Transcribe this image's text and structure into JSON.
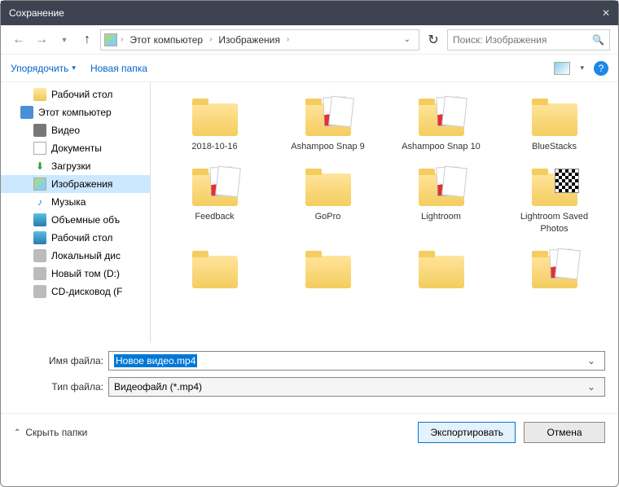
{
  "title": "Сохранение",
  "breadcrumb": {
    "root": "Этот компьютер",
    "current": "Изображения"
  },
  "search_placeholder": "Поиск: Изображения",
  "toolbar": {
    "organize": "Упорядочить",
    "new_folder": "Новая папка"
  },
  "sidebar": [
    {
      "icon": "folder",
      "label": "Рабочий стол",
      "level": 1
    },
    {
      "icon": "pc",
      "label": "Этот компьютер",
      "level": 0
    },
    {
      "icon": "video",
      "label": "Видео",
      "level": 1
    },
    {
      "icon": "doc",
      "label": "Документы",
      "level": 1
    },
    {
      "icon": "dl",
      "label": "Загрузки",
      "level": 1
    },
    {
      "icon": "img",
      "label": "Изображения",
      "level": 1,
      "selected": true
    },
    {
      "icon": "music",
      "label": "Музыка",
      "level": 1
    },
    {
      "icon": "desktop",
      "label": "Объемные объ",
      "level": 1
    },
    {
      "icon": "desktop",
      "label": "Рабочий стол",
      "level": 1
    },
    {
      "icon": "drive",
      "label": "Локальный дис",
      "level": 1
    },
    {
      "icon": "drive",
      "label": "Новый том (D:)",
      "level": 1
    },
    {
      "icon": "drive",
      "label": "CD-дисковод (F",
      "level": 1
    }
  ],
  "files": [
    {
      "label": "2018-10-16",
      "thumb": "folder"
    },
    {
      "label": "Ashampoo Snap 9",
      "thumb": "folder-docs"
    },
    {
      "label": "Ashampoo Snap 10",
      "thumb": "folder-docs"
    },
    {
      "label": "BlueStacks",
      "thumb": "folder"
    },
    {
      "label": "Feedback",
      "thumb": "folder-docs"
    },
    {
      "label": "GoPro",
      "thumb": "folder"
    },
    {
      "label": "Lightroom",
      "thumb": "folder-docs"
    },
    {
      "label": "Lightroom Saved Photos",
      "thumb": "folder-qr"
    },
    {
      "label": "",
      "thumb": "folder"
    },
    {
      "label": "",
      "thumb": "folder"
    },
    {
      "label": "",
      "thumb": "folder"
    },
    {
      "label": "",
      "thumb": "folder-docs"
    }
  ],
  "filename_label": "Имя файла:",
  "filename_value": "Новое видео.mp4",
  "filetype_label": "Тип файла:",
  "filetype_value": "Видеофайл (*.mp4)",
  "hide_folders": "Скрыть папки",
  "export_btn": "Экспортировать",
  "cancel_btn": "Отмена"
}
